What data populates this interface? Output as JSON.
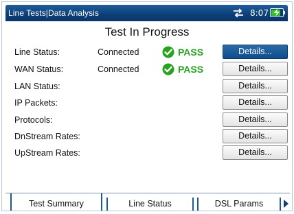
{
  "app": {
    "title": "Line Tests|Data Analysis",
    "time": "8:07"
  },
  "status_icons": {
    "connection_icon": "network-arrows-icon",
    "battery_icon": "battery-charging-icon",
    "battery_level": 0.85
  },
  "page": {
    "heading": "Test In Progress"
  },
  "rows": [
    {
      "label": "Line Status:",
      "value": "Connected",
      "result": "PASS",
      "button": "Details..."
    },
    {
      "label": "WAN Status:",
      "value": "Connected",
      "result": "PASS",
      "button": "Details..."
    },
    {
      "label": "LAN Status:",
      "value": "",
      "result": "",
      "button": "Details..."
    },
    {
      "label": "IP Packets:",
      "value": "",
      "result": "",
      "button": "Details..."
    },
    {
      "label": "Protocols:",
      "value": "",
      "result": "",
      "button": "Details..."
    },
    {
      "label": "DnStream Rates:",
      "value": "",
      "result": "",
      "button": "Details..."
    },
    {
      "label": "UpStream Rates:",
      "value": "",
      "result": "",
      "button": "Details..."
    }
  ],
  "colors": {
    "title_bar": "#0c3f78",
    "pass_green": "#29a31f",
    "selected_button": "#0f4d8c"
  },
  "tabs": [
    {
      "label": "Test Summary",
      "active": true
    },
    {
      "label": "Line Status",
      "active": false
    },
    {
      "label": "DSL Params",
      "active": false
    }
  ],
  "tab_scroll_icon": "triangle-right-icon"
}
